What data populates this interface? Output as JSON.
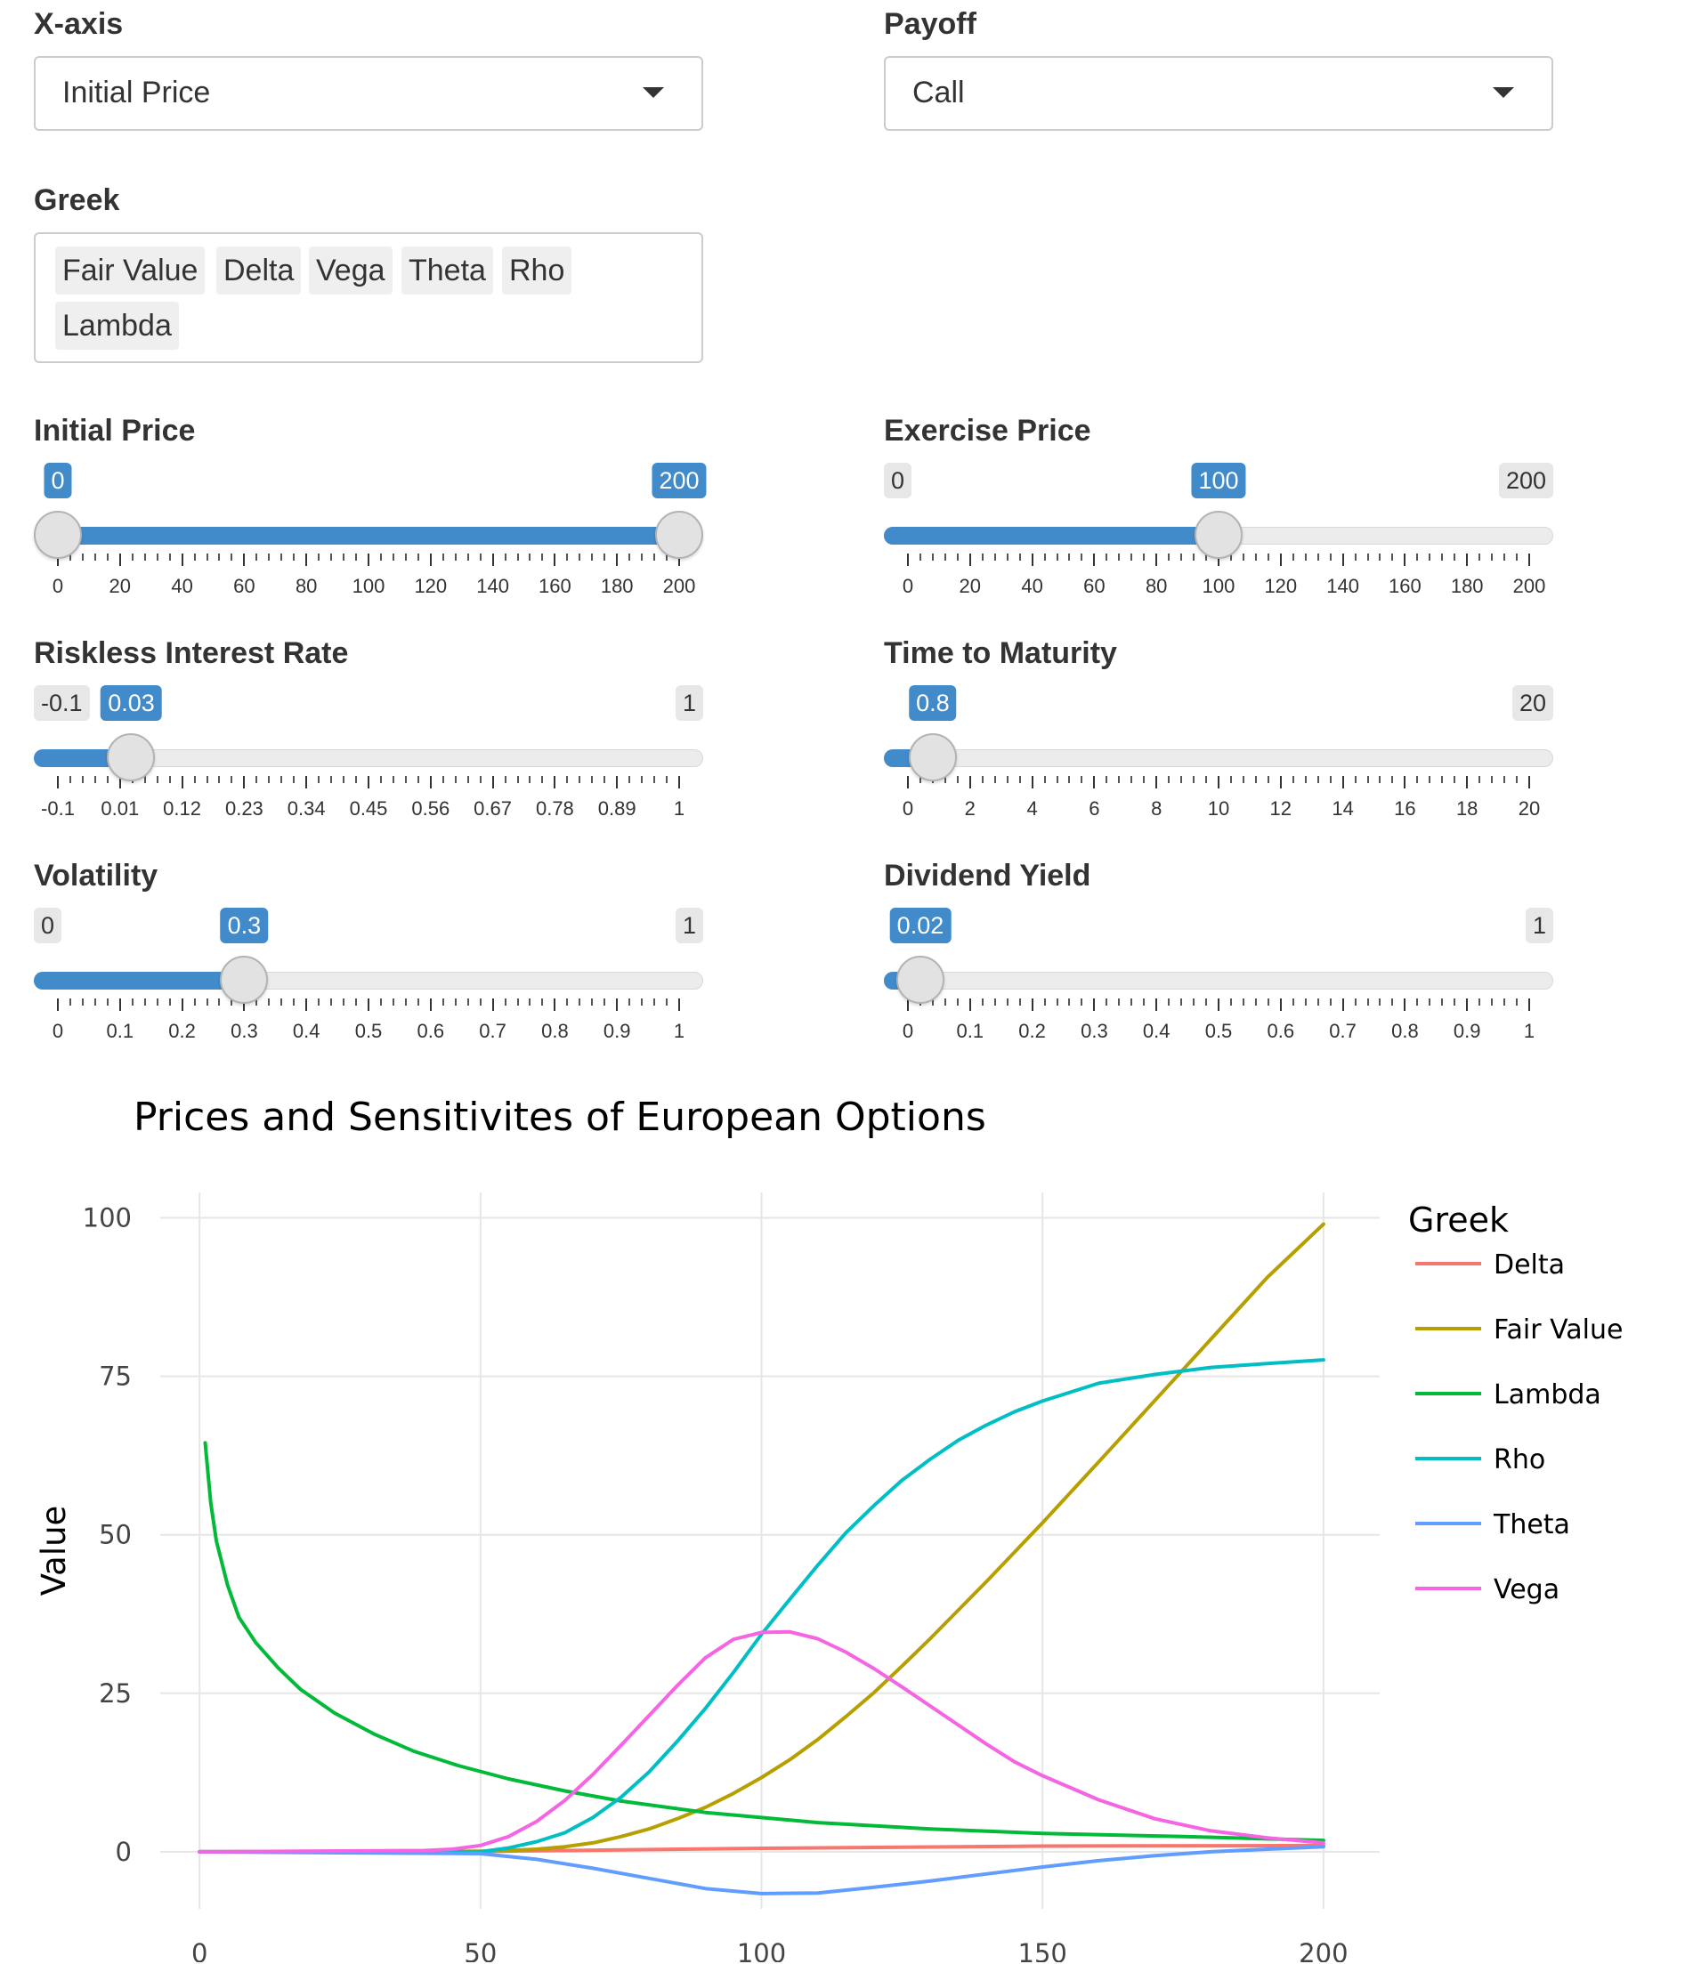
{
  "controls": {
    "xaxis": {
      "label": "X-axis",
      "value": "Initial Price"
    },
    "payoff": {
      "label": "Payoff",
      "value": "Call"
    },
    "greek": {
      "label": "Greek",
      "selected": [
        "Fair Value",
        "Delta",
        "Vega",
        "Theta",
        "Rho",
        "Lambda"
      ]
    },
    "initial_price": {
      "label": "Initial Price",
      "min": 0,
      "max": 200,
      "from": 0,
      "to": 200,
      "from_label": "0",
      "to_label": "200",
      "ticks": [
        "0",
        "20",
        "40",
        "60",
        "80",
        "100",
        "120",
        "140",
        "160",
        "180",
        "200"
      ]
    },
    "exercise_price": {
      "label": "Exercise Price",
      "min": 0,
      "max": 200,
      "value": 100,
      "value_label": "100",
      "min_label": "0",
      "max_label": "200",
      "ticks": [
        "0",
        "20",
        "40",
        "60",
        "80",
        "100",
        "120",
        "140",
        "160",
        "180",
        "200"
      ]
    },
    "interest_rate": {
      "label": "Riskless Interest Rate",
      "min": -0.1,
      "max": 1,
      "value": 0.03,
      "value_label": "0.03",
      "min_label": "-0.1",
      "max_label": "1",
      "ticks": [
        "-0.1",
        "0.01",
        "0.12",
        "0.23",
        "0.34",
        "0.45",
        "0.56",
        "0.67",
        "0.78",
        "0.89",
        "1"
      ]
    },
    "maturity": {
      "label": "Time to Maturity",
      "min": 0,
      "max": 20,
      "value": 0.8,
      "value_label": "0.8",
      "max_label": "20",
      "ticks": [
        "0",
        "2",
        "4",
        "6",
        "8",
        "10",
        "12",
        "14",
        "16",
        "18",
        "20"
      ]
    },
    "volatility": {
      "label": "Volatility",
      "min": 0,
      "max": 1,
      "value": 0.3,
      "value_label": "0.3",
      "min_label": "0",
      "max_label": "1",
      "ticks": [
        "0",
        "0.1",
        "0.2",
        "0.3",
        "0.4",
        "0.5",
        "0.6",
        "0.7",
        "0.8",
        "0.9",
        "1"
      ]
    },
    "dividend": {
      "label": "Dividend Yield",
      "min": 0,
      "max": 1,
      "value": 0.02,
      "value_label": "0.02",
      "max_label": "1",
      "ticks": [
        "0",
        "0.1",
        "0.2",
        "0.3",
        "0.4",
        "0.5",
        "0.6",
        "0.7",
        "0.8",
        "0.9",
        "1"
      ]
    },
    "accent_color": "#428bca"
  },
  "chart_data": {
    "type": "line",
    "title": "Prices and Sensitivites of European Options",
    "xlabel": "Initial Price",
    "ylabel": "Value",
    "xlim": [
      -7,
      210
    ],
    "ylim": [
      -9,
      104
    ],
    "xticks": [
      0,
      50,
      100,
      150,
      200
    ],
    "yticks": [
      0,
      25,
      50,
      75,
      100
    ],
    "grid": true,
    "legend_title": "Greek",
    "legend_position": "right",
    "series": [
      {
        "name": "Delta",
        "color": "#F8766D",
        "x": [
          0,
          50,
          100,
          150,
          200
        ],
        "y": [
          0,
          0.05,
          0.55,
          0.9,
          0.98
        ]
      },
      {
        "name": "Fair Value",
        "color": "#B79F00",
        "x": [
          0,
          40,
          50,
          55,
          60,
          65,
          70,
          75,
          80,
          85,
          90,
          95,
          100,
          105,
          110,
          115,
          120,
          125,
          130,
          140,
          150,
          160,
          170,
          180,
          190,
          200
        ],
        "y": [
          0,
          0,
          0.1,
          0.2,
          0.4,
          0.8,
          1.4,
          2.4,
          3.6,
          5.2,
          7.0,
          9.2,
          11.7,
          14.5,
          17.7,
          21.3,
          25.1,
          29.3,
          33.6,
          42.6,
          51.9,
          61.5,
          71.2,
          80.9,
          90.6,
          99.0
        ]
      },
      {
        "name": "Lambda",
        "color": "#00BA38",
        "x": [
          1,
          2,
          3,
          5,
          7,
          10,
          14,
          18,
          24,
          31,
          38,
          46,
          55,
          65,
          75,
          90,
          110,
          130,
          150,
          175,
          200
        ],
        "y": [
          64.5,
          55,
          49,
          42,
          37,
          33,
          29,
          25.6,
          21.9,
          18.6,
          15.9,
          13.6,
          11.5,
          9.6,
          8.0,
          6.2,
          4.6,
          3.6,
          2.9,
          2.4,
          1.8
        ]
      },
      {
        "name": "Rho",
        "color": "#00BFC4",
        "x": [
          0,
          50,
          55,
          60,
          65,
          70,
          75,
          80,
          85,
          90,
          95,
          100,
          105,
          110,
          115,
          120,
          125,
          130,
          135,
          140,
          145,
          150,
          160,
          170,
          180,
          190,
          200
        ],
        "y": [
          0,
          0,
          0.6,
          1.6,
          3.0,
          5.4,
          8.6,
          12.6,
          17.4,
          22.6,
          28.3,
          34.3,
          39.8,
          45.2,
          50.3,
          54.6,
          58.6,
          61.9,
          64.9,
          67.3,
          69.4,
          71.1,
          73.9,
          75.3,
          76.4,
          77.0,
          77.6
        ]
      },
      {
        "name": "Theta",
        "color": "#619CFF",
        "x": [
          0,
          50,
          60,
          70,
          80,
          90,
          100,
          110,
          120,
          130,
          140,
          150,
          160,
          170,
          180,
          190,
          200
        ],
        "y": [
          0,
          -0.3,
          -1.2,
          -2.6,
          -4.2,
          -5.8,
          -6.6,
          -6.5,
          -5.6,
          -4.6,
          -3.5,
          -2.4,
          -1.4,
          -0.6,
          0.0,
          0.4,
          0.8
        ]
      },
      {
        "name": "Vega",
        "color": "#F564E3",
        "x": [
          0,
          40,
          45,
          50,
          55,
          60,
          65,
          70,
          75,
          80,
          85,
          90,
          95,
          100,
          105,
          110,
          115,
          120,
          125,
          130,
          135,
          140,
          145,
          150,
          160,
          170,
          180,
          190,
          200
        ],
        "y": [
          0,
          0.2,
          0.4,
          1.0,
          2.4,
          4.8,
          8.1,
          12.2,
          16.8,
          21.5,
          26.2,
          30.6,
          33.5,
          34.6,
          34.7,
          33.6,
          31.5,
          28.9,
          26.0,
          23.0,
          20.0,
          17.0,
          14.2,
          12.0,
          8.2,
          5.2,
          3.3,
          2.2,
          1.4
        ]
      }
    ]
  }
}
